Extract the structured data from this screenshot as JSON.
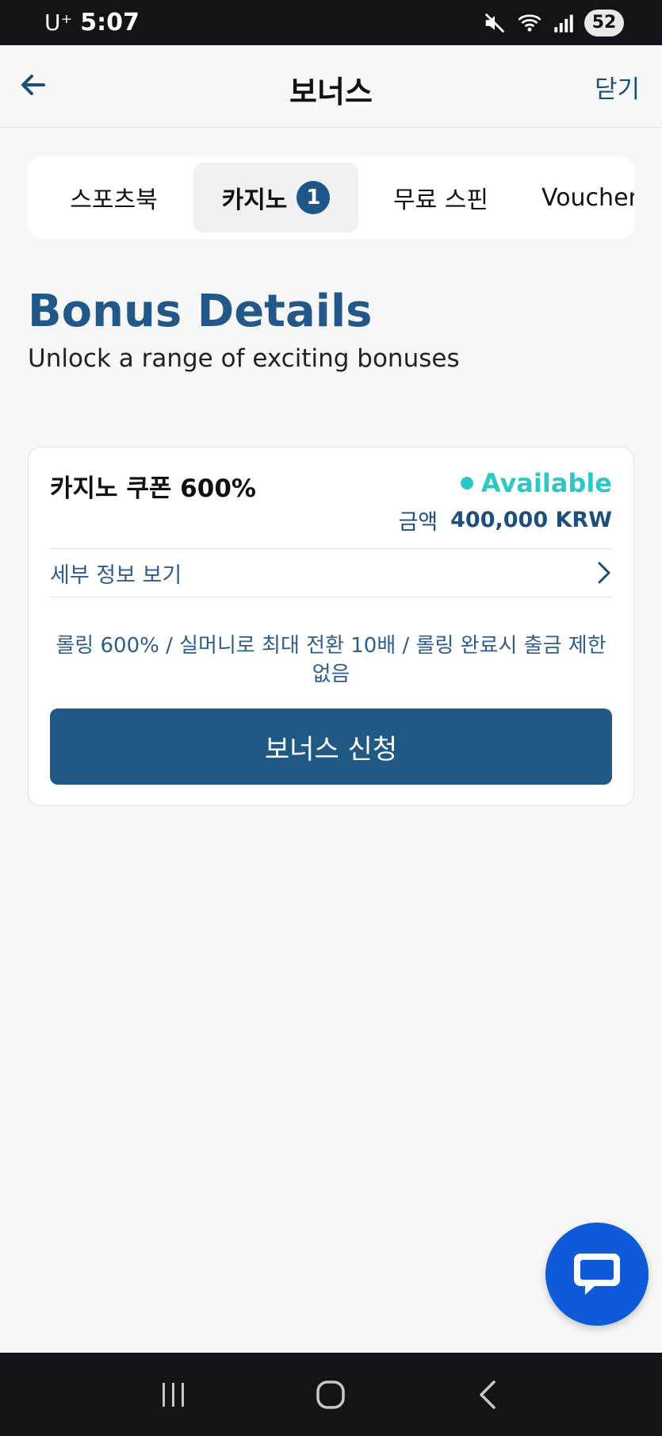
{
  "status_bar": {
    "carrier": "U⁺",
    "time": "5:07",
    "battery": "52"
  },
  "header": {
    "title": "보너스",
    "close_label": "닫기"
  },
  "tabs": [
    {
      "label": "스포츠북"
    },
    {
      "label": "카지노",
      "badge": "1"
    },
    {
      "label": "무료 스핀"
    },
    {
      "label": "Voucher"
    }
  ],
  "intro": {
    "title": "Bonus Details",
    "subtitle": "Unlock a range of exciting bonuses"
  },
  "bonus_card": {
    "title": "카지노 쿠폰 600%",
    "status": "Available",
    "amount_label": "금액",
    "amount_value": "400,000 KRW",
    "details_label": "세부 정보 보기",
    "description": "롤링 600% / 실머니로 최대 전환 10배 / 롤링 완료시 출금 제한 없음",
    "apply_label": "보너스 신청"
  },
  "colors": {
    "accent": "#215985",
    "status_available": "#2ec7c3",
    "chat_fab": "#0f5ad8"
  },
  "icons": {
    "back": "arrow-left-icon",
    "details": "chevron-right-icon",
    "chat": "chat-bubble-icon"
  }
}
